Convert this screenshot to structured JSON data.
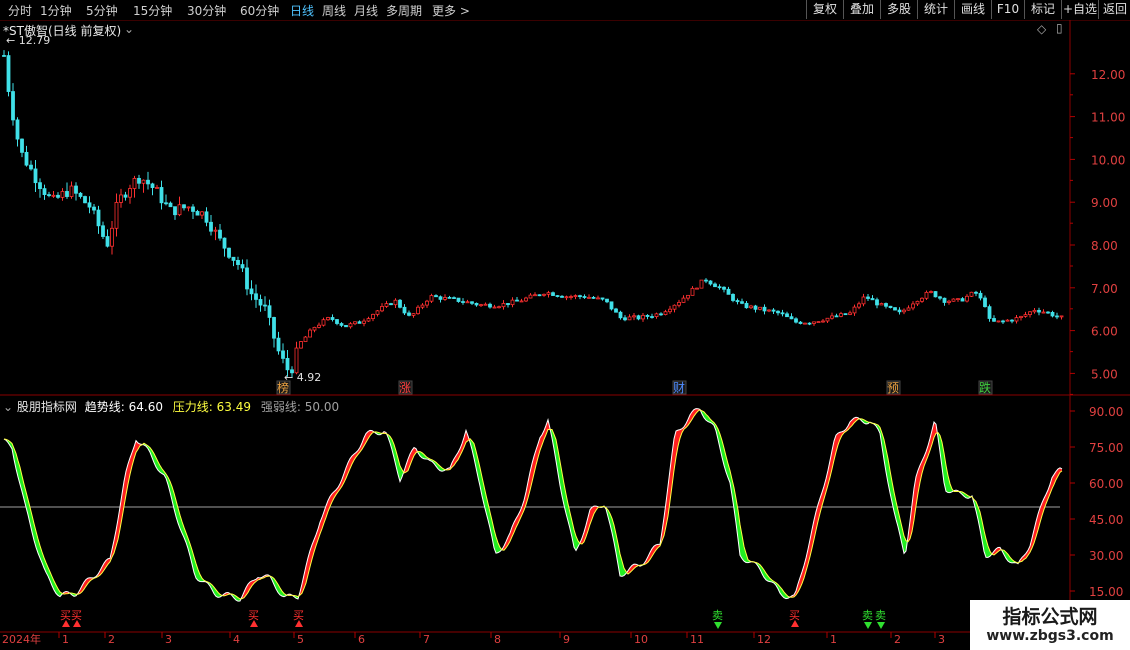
{
  "toolbar": {
    "periods": [
      "分时",
      "1分钟",
      "5分钟",
      "15分钟",
      "30分钟",
      "60分钟",
      "日线",
      "周线",
      "月线",
      "多周期",
      "更多 >"
    ],
    "active_period": "日线",
    "right_buttons": [
      "复权",
      "叠加",
      "多股",
      "统计",
      "画线",
      "F10",
      "标记",
      "+自选",
      "返回"
    ]
  },
  "main_chart": {
    "title": "*ST傲智(日线 前复权)",
    "high_label": "12.79",
    "low_label": "4.92",
    "price_axis": [
      "12.00",
      "11.00",
      "10.00",
      "9.00",
      "8.00",
      "7.00",
      "6.00",
      "5.00"
    ],
    "event_markers": [
      {
        "text": "榜",
        "color": "#e8a040"
      },
      {
        "text": "涨",
        "color": "#ff4040"
      },
      {
        "text": "财",
        "color": "#4f8cff"
      },
      {
        "text": "预",
        "color": "#e8a040"
      },
      {
        "text": "跌",
        "color": "#40d040"
      }
    ]
  },
  "indicator": {
    "name": "股朋指标网",
    "trend_label": "趋势线:",
    "trend_value": "64.60",
    "pressure_label": "压力线:",
    "pressure_value": "63.49",
    "strength_label": "强弱线:",
    "strength_value": "50.00",
    "axis": [
      "90.00",
      "75.00",
      "60.00",
      "45.00",
      "30.00",
      "15.00"
    ],
    "buy_label": "买",
    "sell_label": "卖",
    "colors": {
      "up": "#ff2020",
      "down": "#22ee22",
      "trend": "#ffffff",
      "pressure": "#ffff40",
      "strength": "#a0a0a0"
    }
  },
  "time_axis": [
    "2024年",
    "1",
    "2",
    "3",
    "4",
    "5",
    "6",
    "7",
    "8",
    "9",
    "10",
    "11",
    "12",
    "1",
    "2",
    "3"
  ],
  "watermark": {
    "main": "指标公式网",
    "sub": "www.zbgs3.com"
  }
}
